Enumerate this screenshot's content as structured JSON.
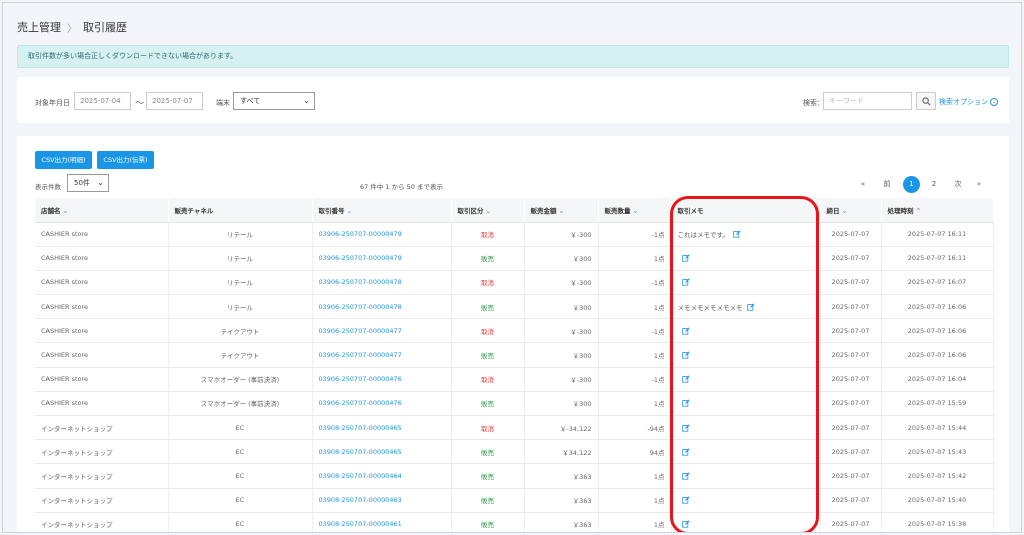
{
  "breadcrumb": {
    "parent": "売上管理",
    "current": "取引履歴"
  },
  "notice": "取引件数が多い場合正しくダウンロードできない場合があります。",
  "filter": {
    "date_label": "対象年月日",
    "date_from": "2025-07-04",
    "tilde": "〜",
    "date_to": "2025-07-07",
    "device_label": "端末",
    "device_value": "すべて",
    "search_label": "検索：",
    "search_placeholder": "キーワード",
    "advanced": "検索オプション"
  },
  "toolbar": {
    "csv_detail": "CSV出力(明細)",
    "csv_slip": "CSV出力(伝票)"
  },
  "page_size": {
    "label": "表示件数",
    "value": "50件"
  },
  "count_text": "67 件中 1 から 50 まで表示",
  "pager": {
    "first": "«",
    "prev": "前",
    "page1": "1",
    "page2": "2",
    "next": "次",
    "last": "»"
  },
  "columns": [
    "店舗名",
    "販売チャネル",
    "取引番号",
    "取引区分",
    "販売金額",
    "販売数量",
    "取引メモ",
    "締日",
    "処理時刻"
  ],
  "rows": [
    {
      "store": "CASHIER store",
      "channel": "リテール",
      "txn": "03906-250707-00000479",
      "type": "取消",
      "amount": "￥-300",
      "qty": "-1点",
      "memo": "これはメモです。",
      "close": "2025-07-07",
      "time": "2025-07-07 16:11"
    },
    {
      "store": "CASHIER store",
      "channel": "リテール",
      "txn": "03906-250707-00000479",
      "type": "販売",
      "amount": "￥300",
      "qty": "1点",
      "memo": "",
      "close": "2025-07-07",
      "time": "2025-07-07 16:11"
    },
    {
      "store": "CASHIER store",
      "channel": "リテール",
      "txn": "03906-250707-00000478",
      "type": "取消",
      "amount": "￥-300",
      "qty": "-1点",
      "memo": "",
      "close": "2025-07-07",
      "time": "2025-07-07 16:07"
    },
    {
      "store": "CASHIER store",
      "channel": "リテール",
      "txn": "03906-250707-00000478",
      "type": "販売",
      "amount": "￥300",
      "qty": "1点",
      "memo": "メモメモメモメモメモ",
      "close": "2025-07-07",
      "time": "2025-07-07 16:06"
    },
    {
      "store": "CASHIER store",
      "channel": "テイクアウト",
      "txn": "03906-250707-00000477",
      "type": "取消",
      "amount": "￥-300",
      "qty": "-1点",
      "memo": "",
      "close": "2025-07-07",
      "time": "2025-07-07 16:06"
    },
    {
      "store": "CASHIER store",
      "channel": "テイクアウト",
      "txn": "03906-250707-00000477",
      "type": "販売",
      "amount": "￥300",
      "qty": "1点",
      "memo": "",
      "close": "2025-07-07",
      "time": "2025-07-07 16:06"
    },
    {
      "store": "CASHIER store",
      "channel": "スマホオーダー (事前決済)",
      "txn": "03906-250707-00000476",
      "type": "取消",
      "amount": "￥-300",
      "qty": "-1点",
      "memo": "",
      "close": "2025-07-07",
      "time": "2025-07-07 16:04"
    },
    {
      "store": "CASHIER store",
      "channel": "スマホオーダー (事前決済)",
      "txn": "03906-250707-00000476",
      "type": "販売",
      "amount": "￥300",
      "qty": "1点",
      "memo": "",
      "close": "2025-07-07",
      "time": "2025-07-07 15:59"
    },
    {
      "store": "インターネットショップ",
      "channel": "EC",
      "txn": "03908-250707-00000465",
      "type": "取消",
      "amount": "￥-34,122",
      "qty": "-94点",
      "memo": "",
      "close": "2025-07-07",
      "time": "2025-07-07 15:44"
    },
    {
      "store": "インターネットショップ",
      "channel": "EC",
      "txn": "03908-250707-00000465",
      "type": "販売",
      "amount": "￥34,122",
      "qty": "94点",
      "memo": "",
      "close": "2025-07-07",
      "time": "2025-07-07 15:43"
    },
    {
      "store": "インターネットショップ",
      "channel": "EC",
      "txn": "03908-250707-00000464",
      "type": "販売",
      "amount": "￥363",
      "qty": "1点",
      "memo": "",
      "close": "2025-07-07",
      "time": "2025-07-07 15:42"
    },
    {
      "store": "インターネットショップ",
      "channel": "EC",
      "txn": "03908-250707-00000463",
      "type": "販売",
      "amount": "￥363",
      "qty": "1点",
      "memo": "",
      "close": "2025-07-07",
      "time": "2025-07-07 15:40"
    },
    {
      "store": "インターネットショップ",
      "channel": "EC",
      "txn": "03908-250707-00000461",
      "type": "販売",
      "amount": "￥363",
      "qty": "1点",
      "memo": "",
      "close": "2025-07-07",
      "time": "2025-07-07 15:38"
    }
  ],
  "colors": {
    "accent": "#1a96e6",
    "cancel": "#e53935",
    "sale": "#2e9c4a",
    "highlight": "#e8141b"
  }
}
